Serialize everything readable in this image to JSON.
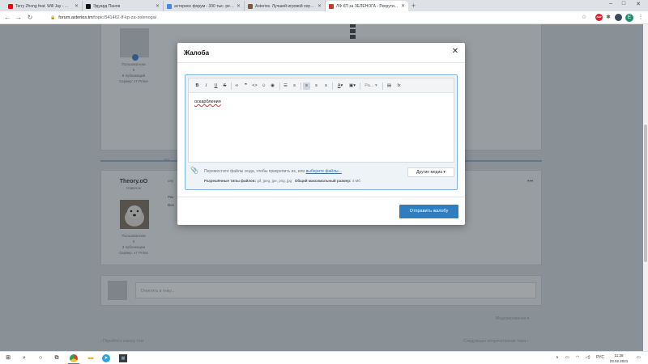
{
  "browser": {
    "tabs": [
      {
        "title": "Terry Zhong feat. Will Jay - ...",
        "icon_color": "#ff0000",
        "active": false
      },
      {
        "title": "Эдуард Панов",
        "icon_color": "#111111",
        "active": false
      },
      {
        "title": "астериос форум - 330 тыс. рез...",
        "icon_color": "#4285f4",
        "active": false
      },
      {
        "title": "Asterios. Лучший игровой серве...",
        "icon_color": "#7a5a3c",
        "active": false
      },
      {
        "title": "ЛФ КП за ЗЕЛЕНОГА - Рекрути...",
        "icon_color": "#c0392b",
        "active": true
      }
    ],
    "new_tab_glyph": "+",
    "url_prefix": "forum.asterios.tm",
    "url_path": "/topic/541462-lf-kp-za-zelenoga/",
    "nav": {
      "back": "←",
      "forward": "→",
      "reload": "↻"
    },
    "lock_glyph": "🔒",
    "profile_letter": "E",
    "window_controls": {
      "minimize": "–",
      "maximize": "□",
      "close": "✕"
    }
  },
  "page": {
    "post1": {
      "role": "Пользователи",
      "rep": "0",
      "posts": "6 публикаций",
      "server": "Сервер: x7 Prime"
    },
    "divider_label": "Нет",
    "post2": {
      "username": "Theory.oO",
      "status": "Новичок",
      "role": "Пользователи",
      "rep": "0",
      "posts": "3 публикации",
      "server": "Сервер: x7 Prime",
      "snippet1": "Раз",
      "snippet2": "Вон",
      "time": "опу"
    },
    "reply_placeholder": "Ответить в тему...",
    "moderation": "Модерирование ▾",
    "prev_link": "Перейти к списку тем",
    "next_link": "Следующая непрочитанная тема"
  },
  "modal": {
    "title": "Жалоба",
    "close_glyph": "✕",
    "editor_text": "оскарбления",
    "toolbar": {
      "bold": "B",
      "italic": "I",
      "underline": "U",
      "strike": "S",
      "link": "∞",
      "quote": "❞",
      "code": "<>",
      "emoji": "☺",
      "spoiler": "◉",
      "ul": "☰",
      "ol": "≡",
      "align_left": "≡",
      "align_center": "≡",
      "align_right": "≡",
      "font_color": "A",
      "bg_color": "▣",
      "font_size": "Ра...",
      "preview": "▤",
      "clear_format": "Ix"
    },
    "attach_text": "Переместите файлы сюда, чтобы прикрепить их, или ",
    "attach_link": "выберите файлы...",
    "allowed_label": "Разрешённые типы файлов:",
    "allowed_types": " gif, jpeg, jpe, png, jpg",
    "max_size_label": "Общий максимальный размер:",
    "max_size": " 4 Мб",
    "more_media": "Другие медиа ▾",
    "submit": "Отправить жалобу"
  },
  "taskbar": {
    "lang": "РУС",
    "time": "11:28",
    "date": "23.02.2021"
  },
  "colors": {
    "accent": "#2f7ec2",
    "modal_border": "#7fb2dd",
    "overlay": "rgba(40,48,56,0.45)"
  }
}
